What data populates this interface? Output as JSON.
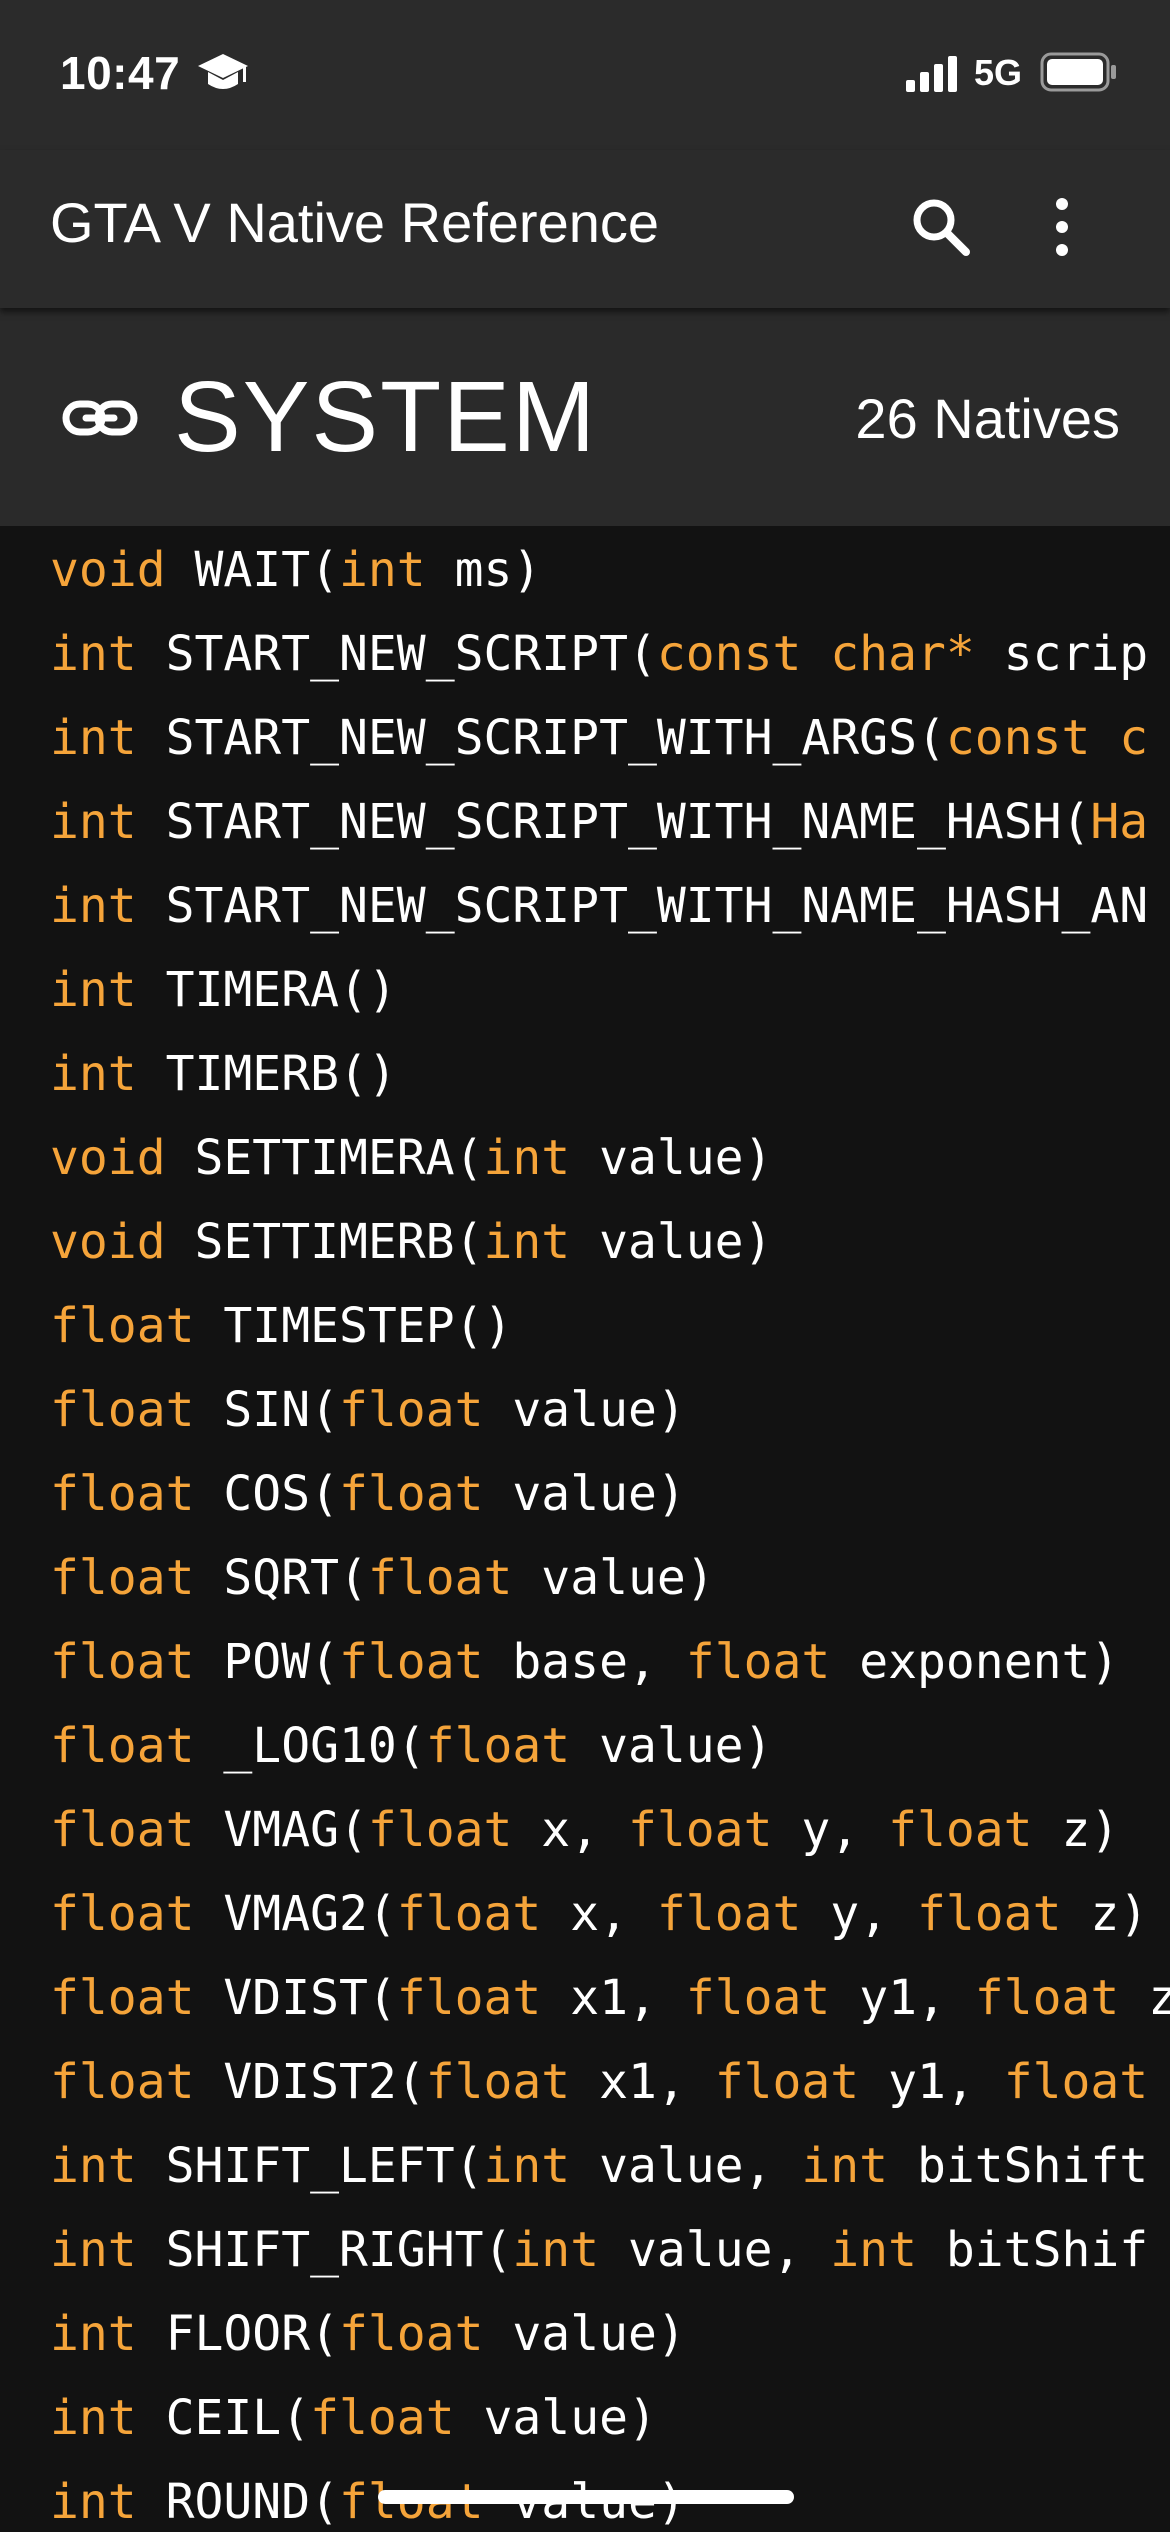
{
  "status_bar": {
    "time": "10:47",
    "network": "5G",
    "icons": [
      "graduation-cap-icon",
      "signal-bars-icon",
      "battery-icon"
    ]
  },
  "app_bar": {
    "title": "GTA V Native Reference",
    "actions": [
      "search-icon",
      "more-vertical-icon"
    ]
  },
  "section": {
    "icon": "link-icon",
    "title": "SYSTEM",
    "count": "26 Natives"
  },
  "colors": {
    "type_keyword": "#f5a43a",
    "text": "#ffffff",
    "background": "#121212",
    "toolbar": "#2b2b2b"
  },
  "natives": [
    [
      [
        "t",
        "void"
      ],
      [
        "n",
        " WAIT("
      ],
      [
        "t",
        "int"
      ],
      [
        "n",
        " ms)"
      ]
    ],
    [
      [
        "t",
        "int"
      ],
      [
        "n",
        " START_NEW_SCRIPT("
      ],
      [
        "t",
        "const char*"
      ],
      [
        "n",
        " scrip"
      ]
    ],
    [
      [
        "t",
        "int"
      ],
      [
        "n",
        " START_NEW_SCRIPT_WITH_ARGS("
      ],
      [
        "t",
        "const c"
      ]
    ],
    [
      [
        "t",
        "int"
      ],
      [
        "n",
        " START_NEW_SCRIPT_WITH_NAME_HASH("
      ],
      [
        "t",
        "Ha"
      ]
    ],
    [
      [
        "t",
        "int"
      ],
      [
        "n",
        " START_NEW_SCRIPT_WITH_NAME_HASH_AN"
      ]
    ],
    [
      [
        "t",
        "int"
      ],
      [
        "n",
        " TIMERA()"
      ]
    ],
    [
      [
        "t",
        "int"
      ],
      [
        "n",
        " TIMERB()"
      ]
    ],
    [
      [
        "t",
        "void"
      ],
      [
        "n",
        " SETTIMERA("
      ],
      [
        "t",
        "int"
      ],
      [
        "n",
        " value)"
      ]
    ],
    [
      [
        "t",
        "void"
      ],
      [
        "n",
        " SETTIMERB("
      ],
      [
        "t",
        "int"
      ],
      [
        "n",
        " value)"
      ]
    ],
    [
      [
        "t",
        "float"
      ],
      [
        "n",
        " TIMESTEP()"
      ]
    ],
    [
      [
        "t",
        "float"
      ],
      [
        "n",
        " SIN("
      ],
      [
        "t",
        "float"
      ],
      [
        "n",
        " value)"
      ]
    ],
    [
      [
        "t",
        "float"
      ],
      [
        "n",
        " COS("
      ],
      [
        "t",
        "float"
      ],
      [
        "n",
        " value)"
      ]
    ],
    [
      [
        "t",
        "float"
      ],
      [
        "n",
        " SQRT("
      ],
      [
        "t",
        "float"
      ],
      [
        "n",
        " value)"
      ]
    ],
    [
      [
        "t",
        "float"
      ],
      [
        "n",
        " POW("
      ],
      [
        "t",
        "float"
      ],
      [
        "n",
        " base, "
      ],
      [
        "t",
        "float"
      ],
      [
        "n",
        " exponent)"
      ]
    ],
    [
      [
        "t",
        "float"
      ],
      [
        "n",
        " _LOG10("
      ],
      [
        "t",
        "float"
      ],
      [
        "n",
        " value)"
      ]
    ],
    [
      [
        "t",
        "float"
      ],
      [
        "n",
        " VMAG("
      ],
      [
        "t",
        "float"
      ],
      [
        "n",
        " x, "
      ],
      [
        "t",
        "float"
      ],
      [
        "n",
        " y, "
      ],
      [
        "t",
        "float"
      ],
      [
        "n",
        " z)"
      ]
    ],
    [
      [
        "t",
        "float"
      ],
      [
        "n",
        " VMAG2("
      ],
      [
        "t",
        "float"
      ],
      [
        "n",
        " x, "
      ],
      [
        "t",
        "float"
      ],
      [
        "n",
        " y, "
      ],
      [
        "t",
        "float"
      ],
      [
        "n",
        " z)"
      ]
    ],
    [
      [
        "t",
        "float"
      ],
      [
        "n",
        " VDIST("
      ],
      [
        "t",
        "float"
      ],
      [
        "n",
        " x1, "
      ],
      [
        "t",
        "float"
      ],
      [
        "n",
        " y1, "
      ],
      [
        "t",
        "float"
      ],
      [
        "n",
        " z"
      ]
    ],
    [
      [
        "t",
        "float"
      ],
      [
        "n",
        " VDIST2("
      ],
      [
        "t",
        "float"
      ],
      [
        "n",
        " x1, "
      ],
      [
        "t",
        "float"
      ],
      [
        "n",
        " y1, "
      ],
      [
        "t",
        "float"
      ]
    ],
    [
      [
        "t",
        "int"
      ],
      [
        "n",
        " SHIFT_LEFT("
      ],
      [
        "t",
        "int"
      ],
      [
        "n",
        " value, "
      ],
      [
        "t",
        "int"
      ],
      [
        "n",
        " bitShift"
      ]
    ],
    [
      [
        "t",
        "int"
      ],
      [
        "n",
        " SHIFT_RIGHT("
      ],
      [
        "t",
        "int"
      ],
      [
        "n",
        " value, "
      ],
      [
        "t",
        "int"
      ],
      [
        "n",
        " bitShif"
      ]
    ],
    [
      [
        "t",
        "int"
      ],
      [
        "n",
        " FLOOR("
      ],
      [
        "t",
        "float"
      ],
      [
        "n",
        " value)"
      ]
    ],
    [
      [
        "t",
        "int"
      ],
      [
        "n",
        " CEIL("
      ],
      [
        "t",
        "float"
      ],
      [
        "n",
        " value)"
      ]
    ],
    [
      [
        "t",
        "int"
      ],
      [
        "n",
        " ROUND("
      ],
      [
        "t",
        "float"
      ],
      [
        "n",
        " value)"
      ]
    ]
  ]
}
